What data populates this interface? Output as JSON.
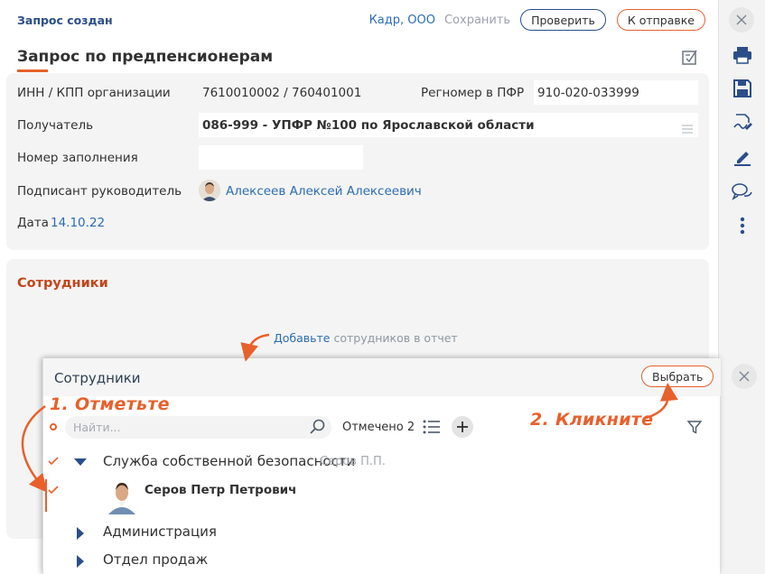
{
  "header": {
    "status": "Запрос создан",
    "org": "Кадр, ООО",
    "save": "Сохранить",
    "check": "Проверить",
    "send": "К отправке"
  },
  "title": "Запрос по предпенсионерам",
  "form": {
    "inn_label": "ИНН / КПП организации",
    "inn_value": "7610010002 / 760401001",
    "reg_label": "Регномер в ПФР",
    "reg_value": "910-020-033999",
    "recipient_label": "Получатель",
    "recipient_value": "086-999 - УПФР №100 по Ярославской области",
    "fill_number_label": "Номер заполнения",
    "fill_number_value": "",
    "signer_label": "Подписант руководитель",
    "signer_name": "Алексеев Алексей Алексеевич",
    "date_label": "Дата",
    "date_value": "14.10.22"
  },
  "employees_section": {
    "title": "Сотрудники",
    "hint_link": "Добавьте",
    "hint_rest": " сотрудников в отчет"
  },
  "dialog": {
    "title": "Сотрудники",
    "select": "Выбрать",
    "search_placeholder": "Найти...",
    "marked": "Отмечено 2",
    "rows": [
      {
        "name": "Служба собственной безопасности",
        "head": "Серов П.П."
      },
      {
        "name": "Серов Петр Петрович"
      },
      {
        "name": "Администрация"
      },
      {
        "name": "Отдел продаж"
      }
    ]
  },
  "annotations": {
    "step1": "1. Отметьте",
    "step2": "2. Кликните"
  },
  "colors": {
    "accent": "#e8602c",
    "brand": "#2b4e8a",
    "link": "#2b6cb3"
  }
}
